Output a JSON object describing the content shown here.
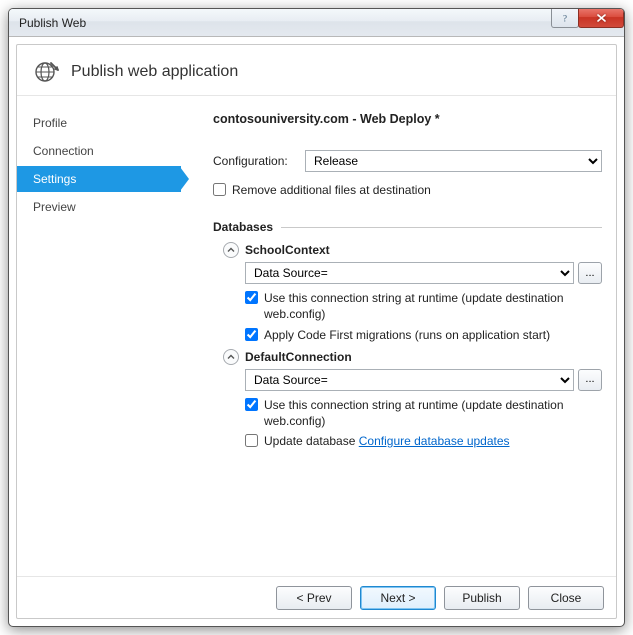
{
  "window": {
    "title": "Publish Web"
  },
  "header": {
    "title": "Publish web application"
  },
  "sidebar": {
    "items": [
      {
        "label": "Profile"
      },
      {
        "label": "Connection"
      },
      {
        "label": "Settings"
      },
      {
        "label": "Preview"
      }
    ],
    "active_index": 2
  },
  "main": {
    "profile_name": "contosouniversity.com - Web Deploy *",
    "config_label": "Configuration:",
    "config_value": "Release",
    "remove_files": {
      "checked": false,
      "label": "Remove additional files at destination"
    },
    "databases_heading": "Databases",
    "db": [
      {
        "name": "SchoolContext",
        "conn": "Data Source=",
        "use_runtime": {
          "checked": true,
          "label": "Use this connection string at runtime (update destination web.config)"
        },
        "second": {
          "checked": true,
          "label": "Apply Code First migrations (runs on application start)"
        },
        "second_link": null
      },
      {
        "name": "DefaultConnection",
        "conn": "Data Source=",
        "use_runtime": {
          "checked": true,
          "label": "Use this connection string at runtime (update destination web.config)"
        },
        "second": {
          "checked": false,
          "label": "Update database"
        },
        "second_link": "Configure database updates"
      }
    ],
    "ellipsis": "..."
  },
  "footer": {
    "prev": "< Prev",
    "next": "Next >",
    "publish": "Publish",
    "close": "Close"
  }
}
